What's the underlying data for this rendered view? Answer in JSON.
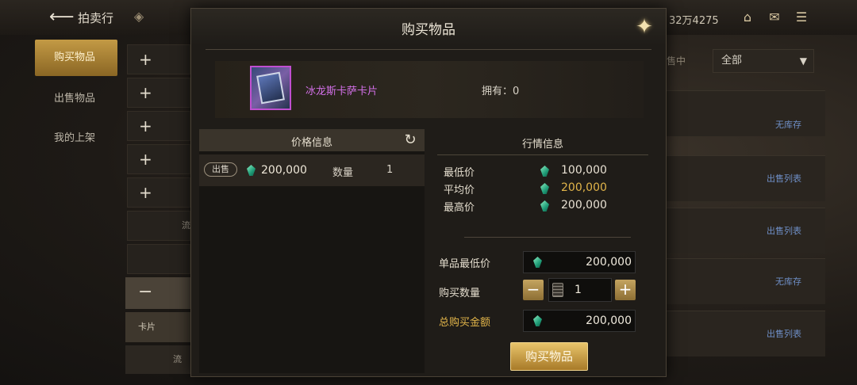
{
  "header": {
    "title": "拍卖行",
    "currency": "32万4275"
  },
  "sidebar": {
    "items": [
      {
        "label": "购买物品"
      },
      {
        "label": "出售物品"
      },
      {
        "label": "我的上架"
      }
    ]
  },
  "background": {
    "filter_label": "售中",
    "filter_value": "全部",
    "rows": [
      {
        "label": "无库存"
      },
      {
        "label": "出售列表"
      },
      {
        "label": "出售列表"
      },
      {
        "label": "无库存"
      },
      {
        "label": "出售列表"
      }
    ],
    "left_card_label": "卡片",
    "left_small_label": "流"
  },
  "modal": {
    "title": "购买物品",
    "item": {
      "name": "冰龙斯卡萨卡片",
      "owned_label": "拥有：0"
    },
    "price_info": {
      "title": "价格信息",
      "listing": {
        "tag": "出售",
        "price": "200,000",
        "qty_label": "数量",
        "qty": "1"
      }
    },
    "market_info": {
      "title": "行情信息",
      "rows": [
        {
          "label": "最低价",
          "value": "100,000"
        },
        {
          "label": "平均价",
          "value": "200,000"
        },
        {
          "label": "最高价",
          "value": "200,000"
        }
      ]
    },
    "form": {
      "unit_min_label": "单品最低价",
      "unit_min_value": "200,000",
      "quantity_label": "购买数量",
      "quantity_value": "1",
      "total_label": "总购买金额",
      "total_value": "200,000",
      "buy_label": "购买物品"
    }
  },
  "colors": {
    "accent_gold": "#e2b54a",
    "item_purple": "#d16fe6",
    "gem_green": "#1f9d78"
  }
}
